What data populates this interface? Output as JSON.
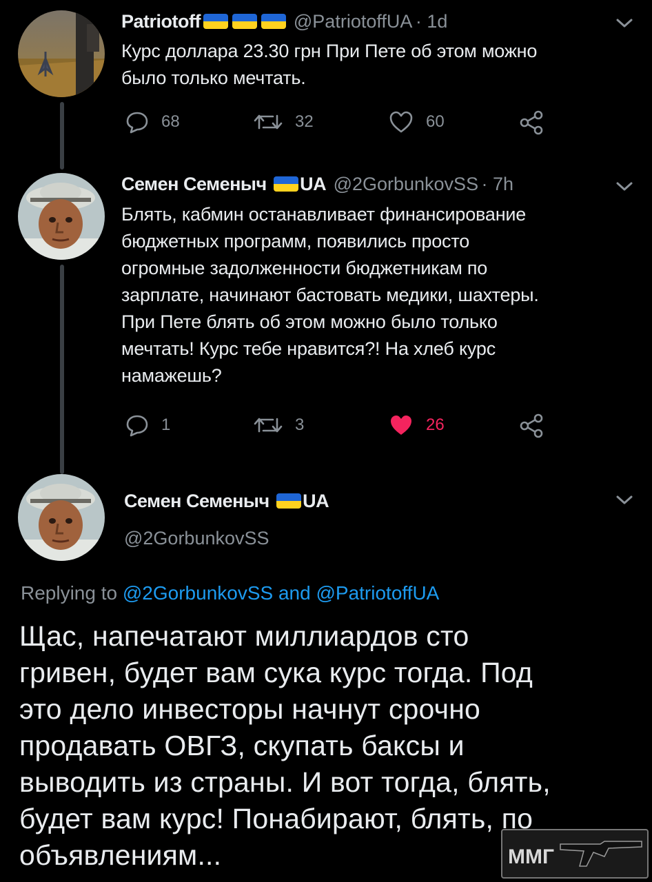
{
  "tweet1": {
    "name": "Patriotoff",
    "flags": [
      "ua-flag",
      "ua-flag",
      "ua-flag"
    ],
    "handle": "@PatriotoffUA",
    "time": "· 1d",
    "text_lines": [
      "Курс доллара 23.30 грн При Пете об этом можно",
      "было только мечтать."
    ],
    "replies": "68",
    "retweets": "32",
    "likes": "60"
  },
  "tweet2": {
    "name": "Семен Семеныч",
    "flag": "ua-flag",
    "name_suffix": "UA",
    "handle": "@2GorbunkovSS",
    "time": "· 7h",
    "text_lines": [
      "Блять, кабмин останавливает финансирование",
      "бюджетных программ, появились просто",
      "огромные задолженности бюджетникам по",
      "зарплате, начинают бастовать медики, шахтеры.",
      "При Пете блять об этом можно было только",
      "мечтать! Курс тебе нравится?! На хлеб курс",
      "намажешь?"
    ],
    "replies": "1",
    "retweets": "3",
    "likes": "26"
  },
  "main": {
    "name": "Семен Семеныч",
    "flag": "ua-flag",
    "name_suffix": "UA",
    "handle": "@2GorbunkovSS",
    "replying_prefix": "Replying to",
    "replying_user1": "@2GorbunkovSS",
    "replying_and": "and",
    "replying_user2": "@PatriotoffUA",
    "text_lines": [
      "Щас, напечатают миллиардов сто",
      "гривен, будет вам сука курс тогда. Под",
      "это дело инвесторы начнут срочно",
      "продавать ОВГЗ, скупать баксы и",
      "выводить из страны. И вот тогда, блять,",
      "будет вам курс! Понабирают, блять, по",
      "объявлениям..."
    ]
  },
  "watermark": {
    "text": "ММГ"
  },
  "colors": {
    "background": "#000000",
    "text": "#e9ecef",
    "muted": "#8a9198",
    "link": "#1d9bf0",
    "like_active": "#f4245e",
    "flag_blue": "#1f66d6",
    "flag_yellow": "#ffd21f"
  },
  "icons": [
    "reply-icon",
    "retweet-icon",
    "heart-icon",
    "share-icon",
    "chevron-down-icon"
  ]
}
